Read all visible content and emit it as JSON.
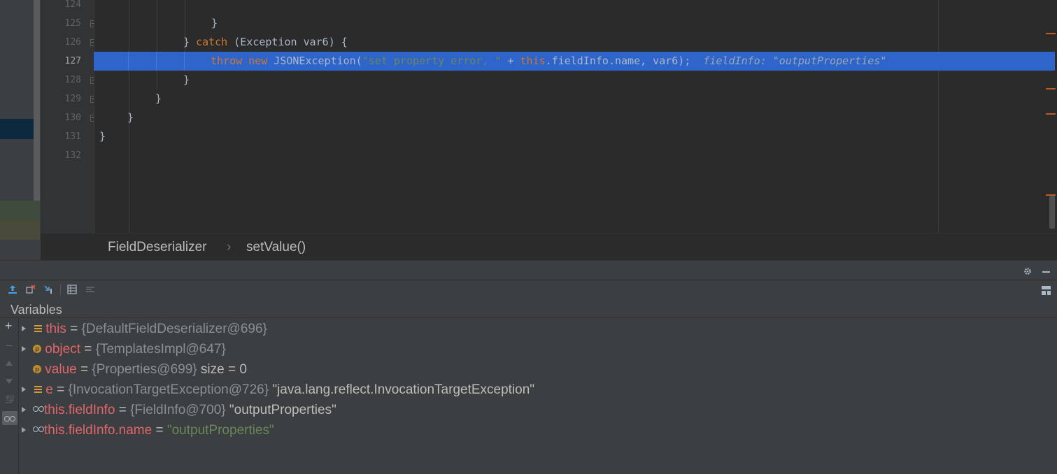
{
  "editor": {
    "lines": [
      {
        "num": "124"
      },
      {
        "num": "125",
        "text": "}"
      },
      {
        "num": "126",
        "text_a": "} ",
        "kw": "catch",
        "text_b": " (Exception var6) {"
      },
      {
        "num": "127",
        "kw1": "throw",
        "kw2": "new",
        "text_a": " JSONException(",
        "str": "\"set property error, \"",
        "text_b": " + ",
        "kw3": "this",
        "text_c": ".fieldInfo.name, var6);",
        "hint": "  fieldInfo: \"outputProperties\""
      },
      {
        "num": "128",
        "text": "}"
      },
      {
        "num": "129",
        "text": "}"
      },
      {
        "num": "130",
        "text": "}"
      },
      {
        "num": "131",
        "text": "}"
      },
      {
        "num": "132"
      }
    ]
  },
  "breadcrumb": {
    "class": "FieldDeserializer",
    "separator": "›",
    "method": "setValue()"
  },
  "debug": {
    "variables_title": "Variables",
    "add_symbol": "+"
  },
  "variables": [
    {
      "icon": "field-icon",
      "name": "this",
      "eq": " = ",
      "ref": "{DefaultFieldDeserializer@696}",
      "extra": ""
    },
    {
      "icon": "parameter-icon",
      "name": "object",
      "eq": " = ",
      "ref": "{TemplatesImpl@647}",
      "extra": ""
    },
    {
      "icon": "parameter-icon",
      "name": "value",
      "eq": " = ",
      "ref": "{Properties@699}",
      "extra": "  size = 0"
    },
    {
      "icon": "field-icon",
      "name": "e",
      "eq": " = ",
      "ref": "{InvocationTargetException@726}",
      "extra": " \"java.lang.reflect.InvocationTargetException\""
    },
    {
      "icon": "watch-icon",
      "name": "this.fieldInfo",
      "eq": " = ",
      "ref": "{FieldInfo@700}",
      "extra": " \"outputProperties\""
    },
    {
      "icon": "watch-icon",
      "name": "this.fieldInfo.name",
      "eq": " = ",
      "ref": "",
      "extra": "\"outputProperties\""
    }
  ],
  "colors": {
    "selection": "#2f65ca",
    "keyword": "#cc7832",
    "string": "#6a8759",
    "var_name": "#e0656b"
  }
}
